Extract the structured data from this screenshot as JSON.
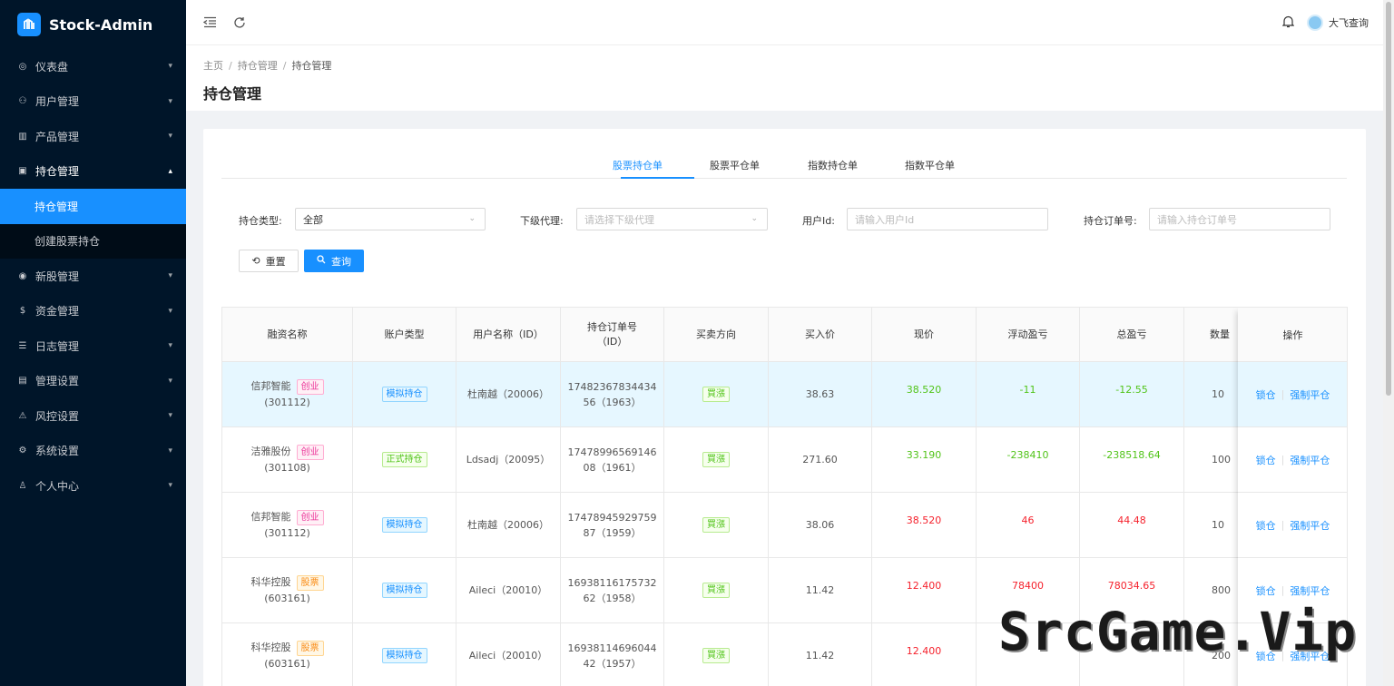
{
  "app": {
    "name": "Stock-Admin"
  },
  "sidebar": {
    "items": [
      {
        "label": "仪表盘",
        "icon": "dashboard-icon"
      },
      {
        "label": "用户管理",
        "icon": "users-icon"
      },
      {
        "label": "产品管理",
        "icon": "chart-icon"
      },
      {
        "label": "持仓管理",
        "icon": "position-icon",
        "open": true
      },
      {
        "label": "新股管理",
        "icon": "broadcast-icon"
      },
      {
        "label": "资金管理",
        "icon": "money-icon"
      },
      {
        "label": "日志管理",
        "icon": "log-icon"
      },
      {
        "label": "管理设置",
        "icon": "settings-panel-icon"
      },
      {
        "label": "风控设置",
        "icon": "warning-icon"
      },
      {
        "label": "系统设置",
        "icon": "gear-icon"
      },
      {
        "label": "个人中心",
        "icon": "user-icon"
      }
    ],
    "sub": [
      {
        "label": "持仓管理",
        "active": true
      },
      {
        "label": "创建股票持仓"
      }
    ]
  },
  "header": {
    "user": "大飞查询"
  },
  "breadcrumb": [
    "主页",
    "持仓管理",
    "持仓管理"
  ],
  "page_title": "持仓管理",
  "tabs": [
    "股票持仓单",
    "股票平仓单",
    "指数持仓单",
    "指数平仓单"
  ],
  "filters": {
    "type_label": "持仓类型:",
    "type_value": "全部",
    "agent_label": "下级代理:",
    "agent_placeholder": "请选择下级代理",
    "userid_label": "用户Id:",
    "userid_placeholder": "请输入用户Id",
    "order_label": "持仓订单号:",
    "order_placeholder": "请输入持仓订单号",
    "reset": "重置",
    "query": "查询"
  },
  "table": {
    "columns": [
      "融资名称",
      "账户类型",
      "用户名称（ID）",
      "持仓订单号（ID）",
      "买卖方向",
      "买入价",
      "现价",
      "浮动盈亏",
      "总盈亏",
      "数量",
      "操作"
    ],
    "rows": [
      {
        "name": "信邦智能",
        "tag": "创业",
        "code": "(301112)",
        "acct": "模拟持仓",
        "user": "杜南越（20006）",
        "order1": "17482367834434",
        "order2": "56（1963）",
        "dir": "買漲",
        "buy": "38.63",
        "now": "38.520",
        "float": "-11",
        "total": "-12.55",
        "qty": "10",
        "color": "green"
      },
      {
        "name": "洁雅股份",
        "tag": "创业",
        "code": "(301108)",
        "acct": "正式持仓",
        "user": "Ldsadj（20095）",
        "order1": "17478996569146",
        "order2": "08（1961）",
        "dir": "買漲",
        "buy": "271.60",
        "now": "33.190",
        "float": "-238410",
        "total": "-238518.64",
        "qty": "100",
        "color": "green"
      },
      {
        "name": "信邦智能",
        "tag": "创业",
        "code": "(301112)",
        "acct": "模拟持仓",
        "user": "杜南越（20006）",
        "order1": "17478945929759",
        "order2": "87（1959）",
        "dir": "買漲",
        "buy": "38.06",
        "now": "38.520",
        "float": "46",
        "total": "44.48",
        "qty": "10",
        "color": "red"
      },
      {
        "name": "科华控股",
        "tag": "股票",
        "code": "(603161)",
        "acct": "模拟持仓",
        "user": "Aileci（20010）",
        "order1": "16938116175732",
        "order2": "62（1958）",
        "dir": "買漲",
        "buy": "11.42",
        "now": "12.400",
        "float": "78400",
        "total": "78034.65",
        "qty": "800",
        "color": "red"
      },
      {
        "name": "科华控股",
        "tag": "股票",
        "code": "(603161)",
        "acct": "模拟持仓",
        "user": "Aileci（20010）",
        "order1": "16938114696044",
        "order2": "42（1957）",
        "dir": "買漲",
        "buy": "11.42",
        "now": "12.400",
        "float": "",
        "total": "",
        "qty": "200",
        "color": "red"
      }
    ],
    "op_lock": "锁仓",
    "op_force": "强制平仓"
  },
  "watermark": "SrcGame.Vip"
}
